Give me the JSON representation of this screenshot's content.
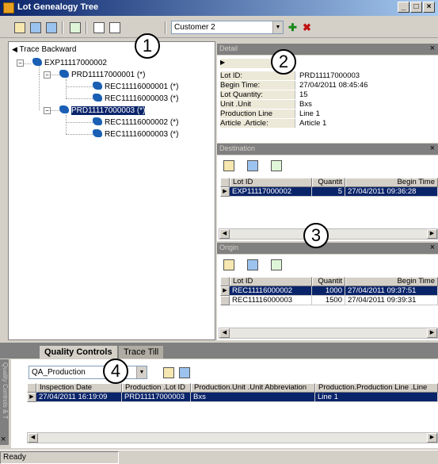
{
  "window": {
    "title": "Lot Genealogy Tree",
    "minimize": "_",
    "maximize": "□",
    "close": "×"
  },
  "toolbar": {
    "customer_value": "Customer 2"
  },
  "tree": {
    "root_label": "Trace Backward",
    "nodes": [
      {
        "label": "EXP11117000002"
      },
      {
        "label": "PRD11117000001 (*)"
      },
      {
        "label": "REC11116000001 (*)"
      },
      {
        "label": "REC11116000003 (*)"
      },
      {
        "label": "PRD11117000003 (*)"
      },
      {
        "label": "REC11116000002 (*)"
      },
      {
        "label": "REC11116000003 (*)"
      }
    ]
  },
  "detail": {
    "header": "Detail",
    "close": "×",
    "rows": [
      {
        "key": "Lot ID:",
        "value": "PRD11117000003"
      },
      {
        "key": "Begin Time:",
        "value": "27/04/2011 08:45:46"
      },
      {
        "key": "Lot Quantity:",
        "value": "15"
      },
      {
        "key": "Unit .Unit",
        "value": "Bxs"
      },
      {
        "key": "Production Line",
        "value": "Line 1"
      },
      {
        "key": "Article .Article:",
        "value": "Article 1"
      }
    ]
  },
  "destination": {
    "header": "Destination",
    "close": "×",
    "columns": [
      "Lot ID",
      "Quantit",
      "Begin Time"
    ],
    "rows": [
      {
        "lot": "EXP11117000002",
        "qty": "5",
        "time": "27/04/2011 09:36:28"
      }
    ]
  },
  "origin": {
    "header": "Origin",
    "close": "×",
    "columns": [
      "Lot ID",
      "Quantit",
      "Begin Time"
    ],
    "rows": [
      {
        "lot": "REC11116000002",
        "qty": "1000",
        "time": "27/04/2011 09:37:51"
      },
      {
        "lot": "REC11116000003",
        "qty": "1500",
        "time": "27/04/2011 09:39:31"
      }
    ]
  },
  "bottom": {
    "tabs": [
      "Quality Controls",
      "Trace Till"
    ],
    "side_strip": "Quality Controls & T",
    "side_close": "×",
    "qa_value": "QA_Production",
    "columns": [
      "Inspection Date",
      "Production .Lot ID",
      "Production.Unit .Unit Abbreviation",
      "Production.Production Line .Line"
    ],
    "rows": [
      {
        "date": "27/04/2011 16:19:09",
        "lot": "PRD11117000003",
        "unit": "Bxs",
        "line": "Line 1"
      }
    ]
  },
  "status": {
    "text": "Ready"
  },
  "callouts": [
    "1",
    "2",
    "3",
    "4"
  ],
  "colors": {
    "selection": "#0a246a",
    "titlebar": "#0a246a",
    "panel_header": "#808080"
  }
}
